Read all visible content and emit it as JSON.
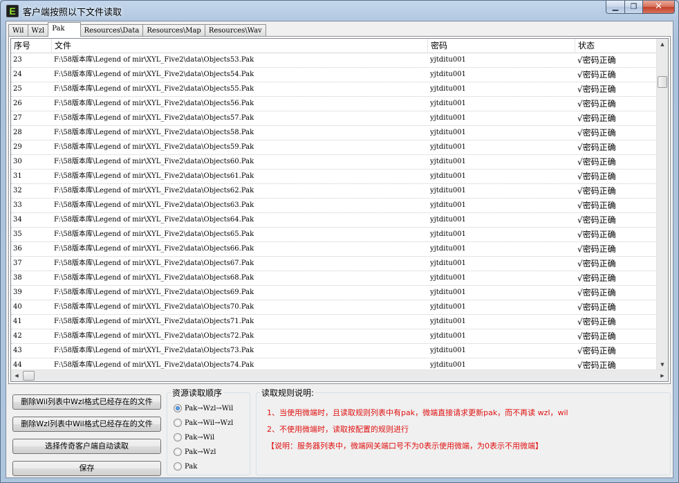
{
  "window": {
    "title": "客户端按照以下文件读取",
    "icon_letter": "E",
    "min_glyph": "▁",
    "max_glyph": "❐",
    "close_glyph": "✕"
  },
  "tabs": [
    {
      "label": "Wil",
      "active": false
    },
    {
      "label": "Wzl",
      "active": false
    },
    {
      "label": "Pak",
      "active": true
    },
    {
      "label": "Resources\\Data",
      "active": false
    },
    {
      "label": "Resources\\Map",
      "active": false
    },
    {
      "label": "Resources\\Wav",
      "active": false
    }
  ],
  "table": {
    "columns": [
      "序号",
      "文件",
      "密码",
      "状态"
    ],
    "rows": [
      [
        "23",
        "F:\\58版本库\\Legend of mir\\XYL_Five2\\data\\Objects53.Pak",
        "yjtditu001",
        "√密码正确"
      ],
      [
        "24",
        "F:\\58版本库\\Legend of mir\\XYL_Five2\\data\\Objects54.Pak",
        "yjtditu001",
        "√密码正确"
      ],
      [
        "25",
        "F:\\58版本库\\Legend of mir\\XYL_Five2\\data\\Objects55.Pak",
        "yjtditu001",
        "√密码正确"
      ],
      [
        "26",
        "F:\\58版本库\\Legend of mir\\XYL_Five2\\data\\Objects56.Pak",
        "yjtditu001",
        "√密码正确"
      ],
      [
        "27",
        "F:\\58版本库\\Legend of mir\\XYL_Five2\\data\\Objects57.Pak",
        "yjtditu001",
        "√密码正确"
      ],
      [
        "28",
        "F:\\58版本库\\Legend of mir\\XYL_Five2\\data\\Objects58.Pak",
        "yjtditu001",
        "√密码正确"
      ],
      [
        "29",
        "F:\\58版本库\\Legend of mir\\XYL_Five2\\data\\Objects59.Pak",
        "yjtditu001",
        "√密码正确"
      ],
      [
        "30",
        "F:\\58版本库\\Legend of mir\\XYL_Five2\\data\\Objects60.Pak",
        "yjtditu001",
        "√密码正确"
      ],
      [
        "31",
        "F:\\58版本库\\Legend of mir\\XYL_Five2\\data\\Objects61.Pak",
        "yjtditu001",
        "√密码正确"
      ],
      [
        "32",
        "F:\\58版本库\\Legend of mir\\XYL_Five2\\data\\Objects62.Pak",
        "yjtditu001",
        "√密码正确"
      ],
      [
        "33",
        "F:\\58版本库\\Legend of mir\\XYL_Five2\\data\\Objects63.Pak",
        "yjtditu001",
        "√密码正确"
      ],
      [
        "34",
        "F:\\58版本库\\Legend of mir\\XYL_Five2\\data\\Objects64.Pak",
        "yjtditu001",
        "√密码正确"
      ],
      [
        "35",
        "F:\\58版本库\\Legend of mir\\XYL_Five2\\data\\Objects65.Pak",
        "yjtditu001",
        "√密码正确"
      ],
      [
        "36",
        "F:\\58版本库\\Legend of mir\\XYL_Five2\\data\\Objects66.Pak",
        "yjtditu001",
        "√密码正确"
      ],
      [
        "37",
        "F:\\58版本库\\Legend of mir\\XYL_Five2\\data\\Objects67.Pak",
        "yjtditu001",
        "√密码正确"
      ],
      [
        "38",
        "F:\\58版本库\\Legend of mir\\XYL_Five2\\data\\Objects68.Pak",
        "yjtditu001",
        "√密码正确"
      ],
      [
        "39",
        "F:\\58版本库\\Legend of mir\\XYL_Five2\\data\\Objects69.Pak",
        "yjtditu001",
        "√密码正确"
      ],
      [
        "40",
        "F:\\58版本库\\Legend of mir\\XYL_Five2\\data\\Objects70.Pak",
        "yjtditu001",
        "√密码正确"
      ],
      [
        "41",
        "F:\\58版本库\\Legend of mir\\XYL_Five2\\data\\Objects71.Pak",
        "yjtditu001",
        "√密码正确"
      ],
      [
        "42",
        "F:\\58版本库\\Legend of mir\\XYL_Five2\\data\\Objects72.Pak",
        "yjtditu001",
        "√密码正确"
      ],
      [
        "43",
        "F:\\58版本库\\Legend of mir\\XYL_Five2\\data\\Objects73.Pak",
        "yjtditu001",
        "√密码正确"
      ],
      [
        "44",
        "F:\\58版本库\\Legend of mir\\XYL_Five2\\data\\Objects74.Pak",
        "yjtditu001",
        "√密码正确"
      ]
    ]
  },
  "scrollbars": {
    "up_arrow": "▲",
    "down_arrow": "▼",
    "left_arrow": "◀",
    "right_arrow": "▶"
  },
  "actions": {
    "delete_wil_in_wzl": "删除Wil列表中Wzl格式已经存在的文件",
    "delete_wzl_in_wil": "删除Wzl列表中Wil格式已经存在的文件",
    "choose_client": "选择传奇客户端自动读取",
    "save": "保存"
  },
  "read_order": {
    "title": "资源读取顺序",
    "options": [
      {
        "label": "Pak→Wzl→Wil",
        "checked": true
      },
      {
        "label": "Pak→Wil→Wzl",
        "checked": false
      },
      {
        "label": "Pak→Wil",
        "checked": false
      },
      {
        "label": "Pak→Wzl",
        "checked": false
      },
      {
        "label": "Pak",
        "checked": false
      }
    ]
  },
  "rules": {
    "title": "读取规则说明:",
    "lines": [
      "1、当使用微端时，且读取规则列表中有pak，微端直接请求更新pak，而不再读 wzl，wil",
      "2、不使用微端时，读取按配置的规则进行",
      "【说明：服务器列表中，微端网关端口号不为0表示使用微端，为0表示不用微端】"
    ],
    "text_color": "#e01010"
  }
}
